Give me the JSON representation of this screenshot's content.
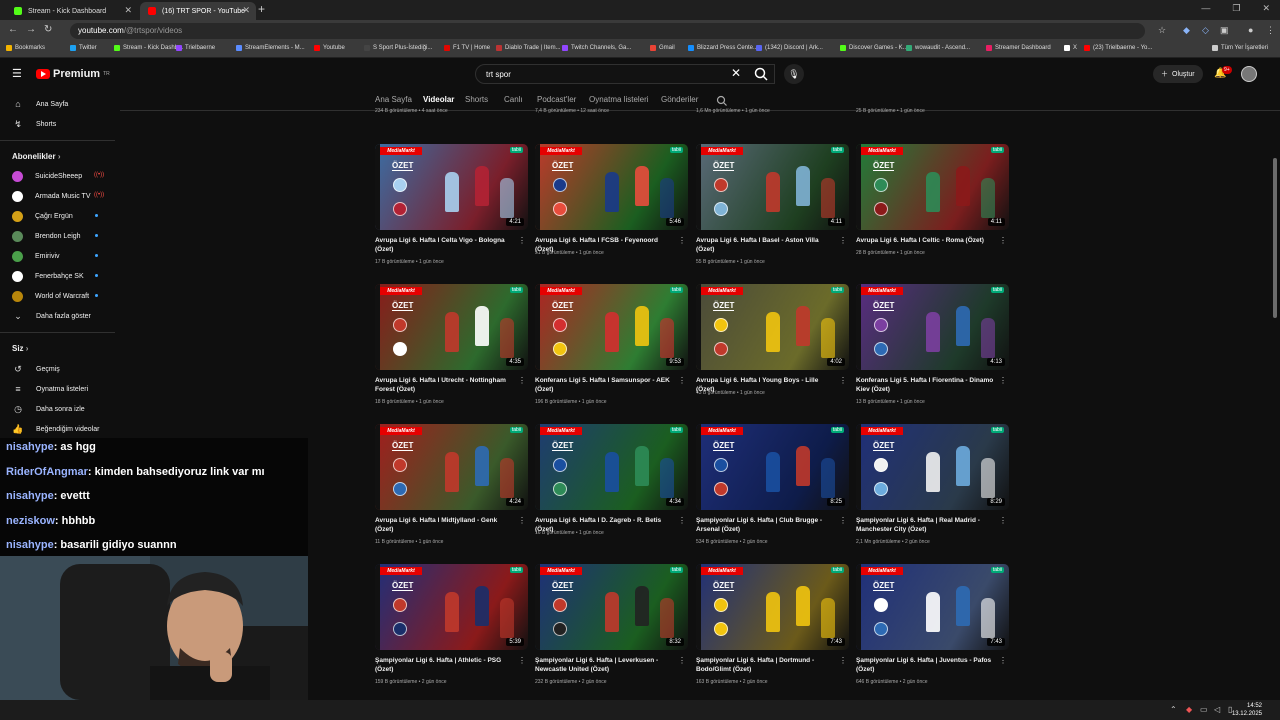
{
  "browser": {
    "tabs": [
      {
        "title": "Stream - Kick Dashboard",
        "favicon_color": "#53fc18"
      },
      {
        "title": "(16) TRT SPOR - YouTube",
        "favicon_color": "#ff0000"
      }
    ],
    "url_host": "youtube.com",
    "url_path": "/@trtspor/videos",
    "bookmarks": [
      {
        "label": "Bookmarks",
        "color": "#f4b400"
      },
      {
        "label": "Twitter",
        "color": "#1da1f2"
      },
      {
        "label": "Stream - Kick Dashb...",
        "color": "#53fc18"
      },
      {
        "label": "Trielbaerne",
        "color": "#9146ff"
      },
      {
        "label": "StreamElements - M...",
        "color": "#5b8cff"
      },
      {
        "label": "Youtube",
        "color": "#ff0000"
      },
      {
        "label": "S Sport Plus-İstediği...",
        "color": "#444444"
      },
      {
        "label": "F1 TV | Home",
        "color": "#e10600"
      },
      {
        "label": "Diablo Trade | Item...",
        "color": "#b33"
      },
      {
        "label": "Twitch Channels, Ga...",
        "color": "#9146ff"
      },
      {
        "label": "Gmail",
        "color": "#ea4335"
      },
      {
        "label": "Blizzard Press Cente...",
        "color": "#148eff"
      },
      {
        "label": "(1342) Discord | Ark...",
        "color": "#5865f2"
      },
      {
        "label": "Discover Games - K...",
        "color": "#53fc18"
      },
      {
        "label": "wowaudit - Ascend...",
        "color": "#3a7"
      },
      {
        "label": "Streamer Dashboard",
        "color": "#e91e63"
      },
      {
        "label": "X",
        "color": "#ffffff"
      },
      {
        "label": "(23) Trielbaerne - Yo...",
        "color": "#ff0000"
      },
      {
        "label": "Tüm Yer İşaretleri",
        "color": "#cccccc"
      }
    ]
  },
  "youtube": {
    "logo_text": "Premium",
    "logo_sup": "TR",
    "search_value": "trt spor",
    "create_label": "Oluştur",
    "notif_badge": "9+",
    "sidebar": {
      "home": "Ana Sayfa",
      "shorts": "Shorts",
      "subs_header": "Abonelikler",
      "subs": [
        {
          "name": "SuicideSheeep",
          "color": "#c64bd4",
          "live": true
        },
        {
          "name": "Armada Music TV",
          "color": "#ffffff",
          "live": true
        },
        {
          "name": "Çağrı Ergün",
          "color": "#d4a017",
          "live": false
        },
        {
          "name": "Brendon Leigh",
          "color": "#5a8a5a",
          "live": false
        },
        {
          "name": "Emiriviv",
          "color": "#4a9f4a",
          "live": false
        },
        {
          "name": "Fenerbahçe SK",
          "color": "#ffffff",
          "live": false
        },
        {
          "name": "World of Warcraft",
          "color": "#b8860b",
          "live": false
        }
      ],
      "show_more": "Daha fazla göster",
      "you_header": "Siz",
      "you_items": [
        "Geçmiş",
        "Oynatma listeleri",
        "Daha sonra izle",
        "Beğendiğim videolar"
      ]
    },
    "channel_tabs": [
      "Ana Sayfa",
      "Videolar",
      "Shorts",
      "Canlı",
      "Podcast'ler",
      "Oynatma listeleri",
      "Gönderiler"
    ],
    "active_tab": "Videolar",
    "prev_row_meta": [
      "234 B görüntüleme • 4 saat önce",
      "7,4 B görüntüleme • 12 saat önce",
      "1,6 Mn görüntüleme • 1 gün önce",
      "25 B görüntüleme • 1 gün önce"
    ],
    "videos": [
      {
        "title": "Avrupa Ligi 6. Hafta l Celta Vigo - Bologna (Özet)",
        "meta": "17 B görüntüleme • 1 gün önce",
        "duration": "4:21",
        "bg": "#3a6ea5",
        "bg2": "#7a1f2b",
        "c1": "#a8d0f0",
        "c2": "#b22234",
        "lines": 2
      },
      {
        "title": "Avrupa Ligi 6. Hafta l FCSB - Feyenoord (Özet)",
        "meta": "51 B görüntüleme • 1 gün önce",
        "duration": "5:46",
        "bg": "#c0392b",
        "bg2": "#1b5e20",
        "c1": "#1a3a8a",
        "c2": "#e74c3c",
        "lines": 1
      },
      {
        "title": "Avrupa Ligi 6. Hafta l Basel - Aston Villa (Özet)",
        "meta": "55 B görüntüleme • 1 gün önce",
        "duration": "4:11",
        "bg": "#5b6b7a",
        "bg2": "#1e3f20",
        "c1": "#c0392b",
        "c2": "#7fb3d5",
        "lines": 2
      },
      {
        "title": "Avrupa Ligi 6. Hafta l Celtic - Roma (Özet)",
        "meta": "28 B görüntüleme • 1 gün önce",
        "duration": "4:11",
        "bg": "#1e7f3a",
        "bg2": "#7b1e1e",
        "c1": "#2e8b57",
        "c2": "#8b1a1a",
        "lines": 1
      },
      {
        "title": "Avrupa Ligi 6. Hafta l Utrecht - Nottingham Forest (Özet)",
        "meta": "18 B görüntüleme • 1 gün önce",
        "duration": "4:35",
        "bg": "#8b1a1a",
        "bg2": "#2d6a2d",
        "c1": "#c0392b",
        "c2": "#ffffff",
        "lines": 2
      },
      {
        "title": "Konferans Ligi 5. Hafta l Samsunspor - AEK (Özet)",
        "meta": "196 B görüntüleme • 1 gün önce",
        "duration": "9:53",
        "bg": "#b22222",
        "bg2": "#2e7d32",
        "c1": "#d32f2f",
        "c2": "#f1c40f",
        "lines": 2
      },
      {
        "title": "Avrupa Ligi 6. Hafta l Young Boys - Lille (Özet)",
        "meta": "43 B görüntüleme • 1 gün önce",
        "duration": "4:02",
        "bg": "#4a4a3a",
        "bg2": "#6b6b2a",
        "c1": "#f1c40f",
        "c2": "#c0392b",
        "lines": 1
      },
      {
        "title": "Konferans Ligi 5. Hafta l Fiorentina - Dinamo Kiev (Özet)",
        "meta": "13 B görüntüleme • 1 gün önce",
        "duration": "4:13",
        "bg": "#5b2c83",
        "bg2": "#1e3a2a",
        "c1": "#7b3fa0",
        "c2": "#2d6ab4",
        "lines": 2
      },
      {
        "title": "Avrupa Ligi 6. Hafta l Midtjylland - Genk (Özet)",
        "meta": "11 B görüntüleme • 1 gün önce",
        "duration": "4:24",
        "bg": "#a31d1d",
        "bg2": "#3a5a2a",
        "c1": "#c0392b",
        "c2": "#2d6ab4",
        "lines": 2
      },
      {
        "title": "Avrupa Ligi 6. Hafta l D. Zagreb - R. Betis (Özet)",
        "meta": "16 B görüntüleme • 1 gün önce",
        "duration": "4:34",
        "bg": "#1f3b73",
        "bg2": "#1b5e20",
        "c1": "#1a4fa0",
        "c2": "#2e8b57",
        "lines": 1
      },
      {
        "title": "Şampiyonlar Ligi 6. Hafta | Club Brugge - Arsenal (Özet)",
        "meta": "534 B görüntüleme • 2 gün önce",
        "duration": "8:25",
        "bg": "#1f2f7a",
        "bg2": "#0e1c4a",
        "c1": "#1a4fa0",
        "c2": "#c0392b",
        "lines": 2
      },
      {
        "title": "Şampiyonlar Ligi 6. Hafta | Real Madrid - Manchester City (Özet)",
        "meta": "2,1 Mn görüntüleme • 2 gün önce",
        "duration": "8:29",
        "bg": "#1f2f7a",
        "bg2": "#2a3a4a",
        "c1": "#f1f1f1",
        "c2": "#6cabdd",
        "lines": 2
      },
      {
        "title": "Şampiyonlar Ligi 6. Hafta | Athletic - PSG (Özet)",
        "meta": "159 B görüntüleme • 2 gün önce",
        "duration": "5:39",
        "bg": "#1f2f7a",
        "bg2": "#8b1a1a",
        "c1": "#c0392b",
        "c2": "#1a2f6a",
        "lines": 2
      },
      {
        "title": "Şampiyonlar Ligi 6. Hafta | Leverkusen - Newcastle United (Özet)",
        "meta": "232 B görüntüleme • 2 gün önce",
        "duration": "8:32",
        "bg": "#1f2f7a",
        "bg2": "#1b5e20",
        "c1": "#c0392b",
        "c2": "#222222",
        "lines": 2
      },
      {
        "title": "Şampiyonlar Ligi 6. Hafta | Dortmund - Bodo/Glimt (Özet)",
        "meta": "163 B görüntüleme • 2 gün önce",
        "duration": "7:43",
        "bg": "#1f2f7a",
        "bg2": "#6b5a1a",
        "c1": "#f1c40f",
        "c2": "#f1c40f",
        "lines": 2
      },
      {
        "title": "Şampiyonlar Ligi 6. Hafta | Juventus - Pafos (Özet)",
        "meta": "646 B görüntüleme • 2 gün önce",
        "duration": "7:43",
        "bg": "#1f2f7a",
        "bg2": "#3a4a6a",
        "c1": "#ffffff",
        "c2": "#2d6ab4",
        "lines": 2
      }
    ],
    "thumb_brand": "MediaMarkt",
    "thumb_badge": "ÖZET",
    "thumb_tabii": "tabii"
  },
  "chat": [
    {
      "user": "nisahype",
      "text": ": as hgg"
    },
    {
      "user": "RiderOfAngmar",
      "text": ": kimden bahsediyoruz link var mı"
    },
    {
      "user": "nisahype",
      "text": ": evettt"
    },
    {
      "user": "neziskow",
      "text": ": hbhbb"
    },
    {
      "user": "nisahype",
      "text": ": basarili gidiyo suannn"
    }
  ],
  "taskbar": {
    "time": "14:52",
    "date": "13.12.2025"
  }
}
